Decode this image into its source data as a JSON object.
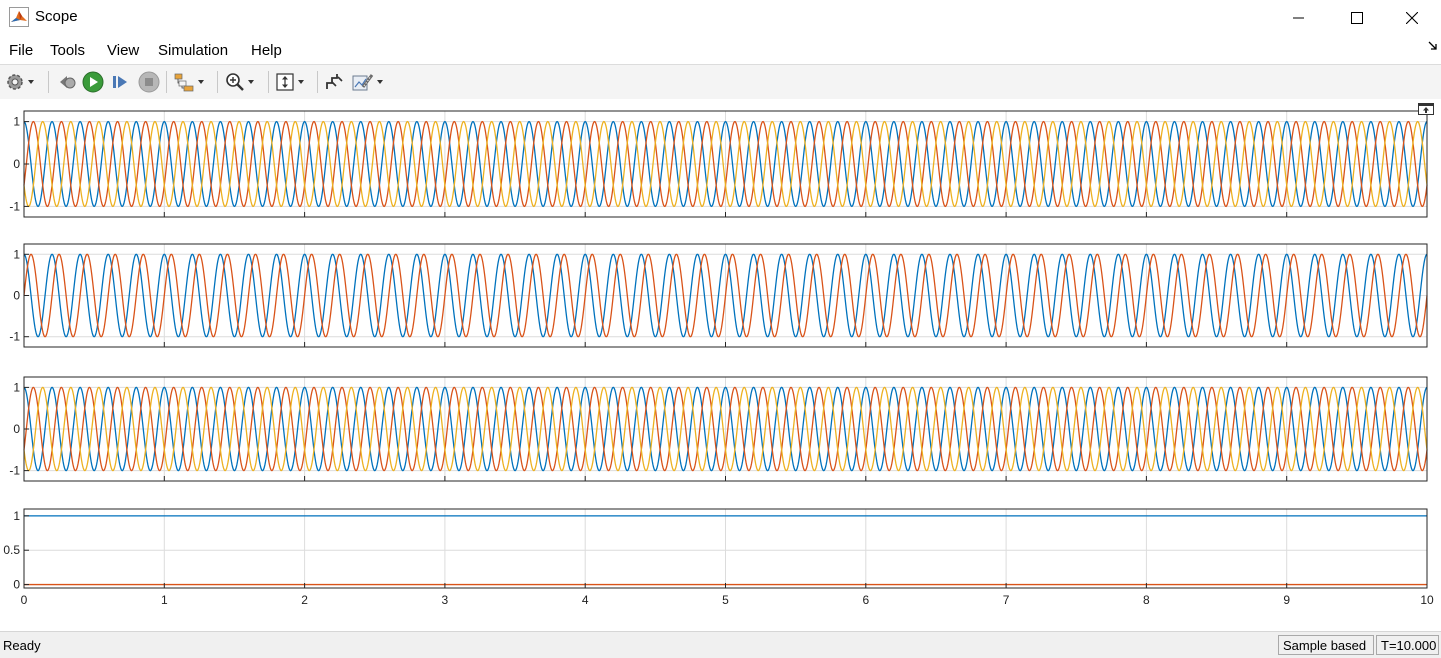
{
  "window": {
    "title": "Scope",
    "icon": "matlab-peaks-icon",
    "controls": [
      "minimize-icon",
      "maximize-icon",
      "close-icon"
    ]
  },
  "menu": {
    "items": [
      "File",
      "Tools",
      "View",
      "Simulation",
      "Help"
    ]
  },
  "toolbar": {
    "icons": [
      "settings-gear-icon",
      "step-back-icon",
      "run-icon",
      "step-forward-icon",
      "stop-icon",
      "signal-select-icon",
      "zoom-in-icon",
      "scale-axes-icon",
      "highlight-icon",
      "measurements-icon"
    ]
  },
  "status": {
    "ready": "Ready",
    "mode": "Sample based",
    "time": "T=10.000"
  },
  "colors": {
    "blue": "#0072bd",
    "orange": "#d95319",
    "yellow": "#edb120"
  },
  "chart_data": [
    {
      "type": "line",
      "x_range": [
        0,
        10
      ],
      "ylim": [
        -1.25,
        1.25
      ],
      "yticks": [
        {
          "v": 1,
          "label": "1"
        },
        {
          "v": 0,
          "label": "0"
        },
        {
          "v": -1,
          "label": "-1"
        }
      ],
      "grid": true,
      "series": [
        {
          "color": "#0072bd",
          "function": "cos",
          "frequency_hz": 5,
          "phase_deg": 0,
          "amplitude": 1
        },
        {
          "color": "#d95319",
          "function": "cos",
          "frequency_hz": 5,
          "phase_deg": -120,
          "amplitude": 1
        },
        {
          "color": "#edb120",
          "function": "cos",
          "frequency_hz": 5,
          "phase_deg": 120,
          "amplitude": 1
        }
      ]
    },
    {
      "type": "line",
      "x_range": [
        0,
        10
      ],
      "ylim": [
        -1.25,
        1.25
      ],
      "yticks": [
        {
          "v": 1,
          "label": "1"
        },
        {
          "v": 0,
          "label": "0"
        },
        {
          "v": -1,
          "label": "-1"
        }
      ],
      "grid": true,
      "series": [
        {
          "color": "#0072bd",
          "function": "cos",
          "frequency_hz": 5,
          "phase_deg": 0,
          "amplitude": 1
        },
        {
          "color": "#d95319",
          "function": "sin",
          "frequency_hz": 5,
          "phase_deg": 0,
          "amplitude": 1
        }
      ]
    },
    {
      "type": "line",
      "x_range": [
        0,
        10
      ],
      "ylim": [
        -1.25,
        1.25
      ],
      "yticks": [
        {
          "v": 1,
          "label": "1"
        },
        {
          "v": 0,
          "label": "0"
        },
        {
          "v": -1,
          "label": "-1"
        }
      ],
      "grid": true,
      "series": [
        {
          "color": "#0072bd",
          "function": "cos",
          "frequency_hz": 5,
          "phase_deg": 0,
          "amplitude": 1
        },
        {
          "color": "#d95319",
          "function": "cos",
          "frequency_hz": 5,
          "phase_deg": -120,
          "amplitude": 1
        },
        {
          "color": "#edb120",
          "function": "cos",
          "frequency_hz": 5,
          "phase_deg": 120,
          "amplitude": 1
        }
      ]
    },
    {
      "type": "line",
      "x_range": [
        0,
        10
      ],
      "ylim": [
        -0.05,
        1.1
      ],
      "yticks": [
        {
          "v": 1,
          "label": "1"
        },
        {
          "v": 0.5,
          "label": "0.5"
        },
        {
          "v": 0,
          "label": "0"
        }
      ],
      "grid": true,
      "series": [
        {
          "color": "#0072bd",
          "function": "const",
          "value": 1
        },
        {
          "color": "#d95319",
          "function": "const",
          "value": 0
        }
      ],
      "xticks": [
        "0",
        "1",
        "2",
        "3",
        "4",
        "5",
        "6",
        "7",
        "8",
        "9",
        "10"
      ]
    }
  ]
}
